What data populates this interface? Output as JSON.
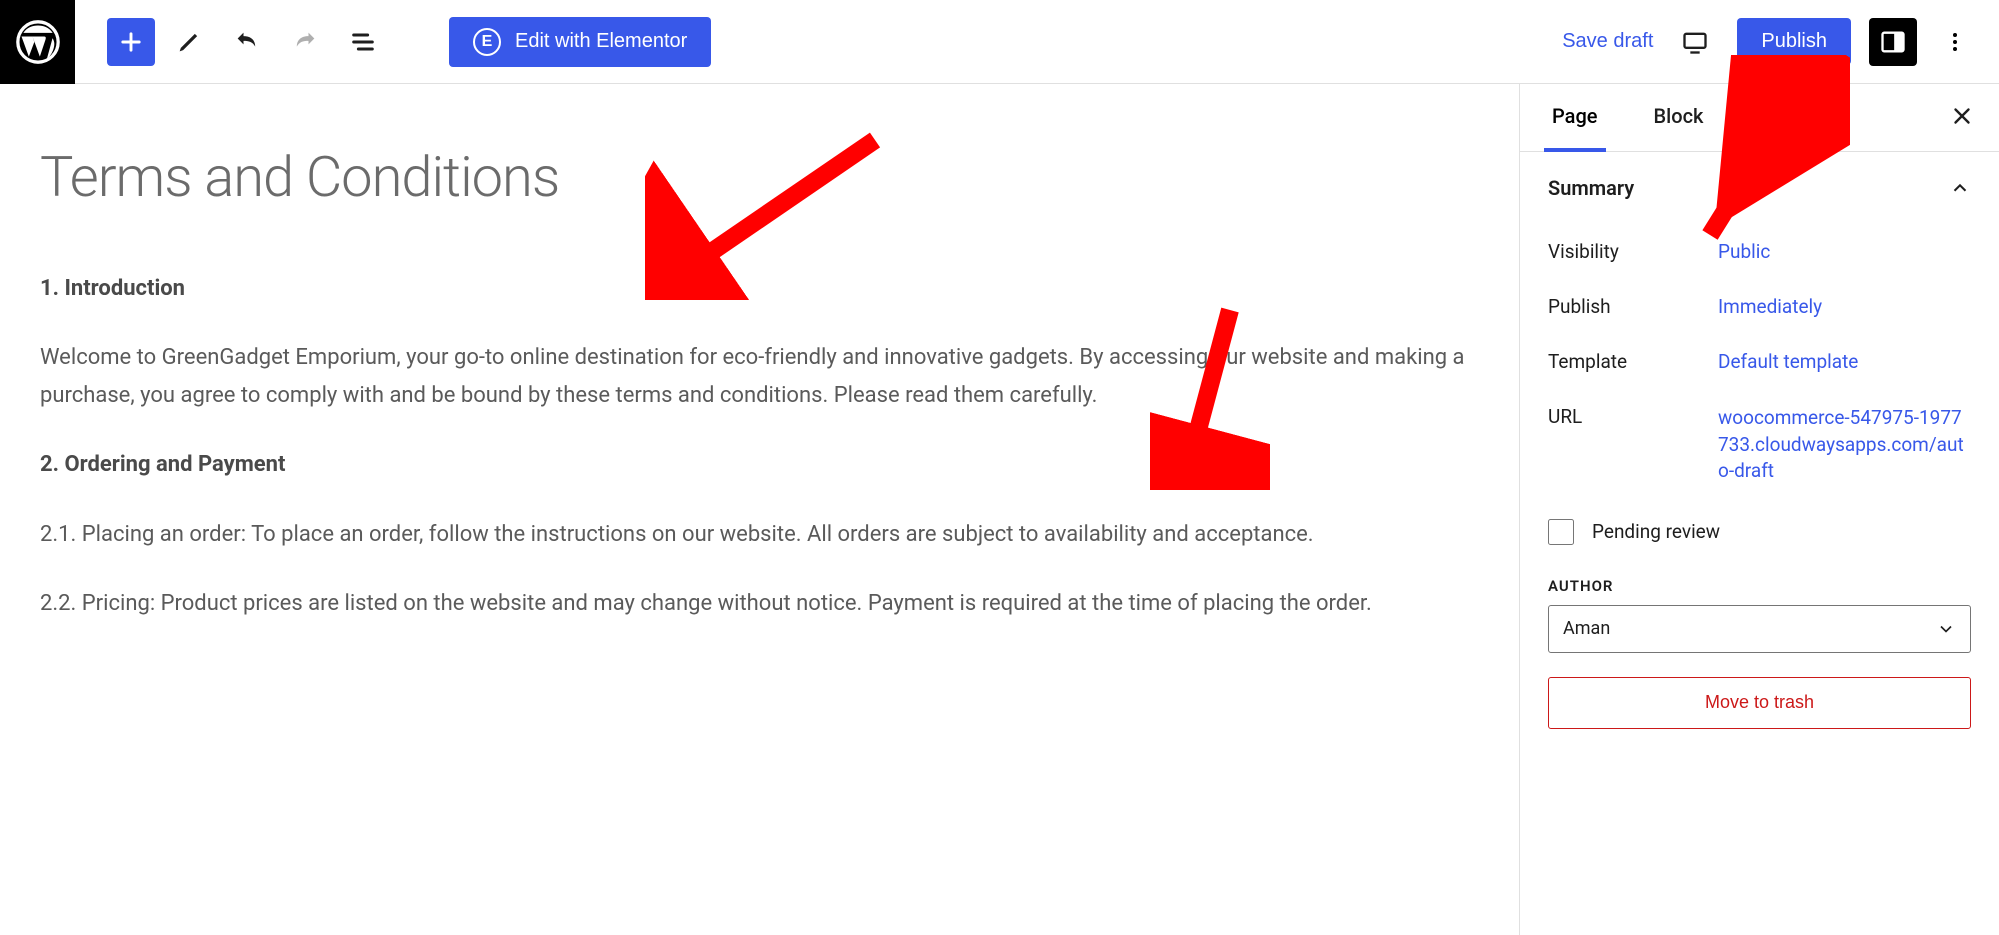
{
  "toolbar": {
    "elementor_label": "Edit with Elementor",
    "save_draft": "Save draft",
    "publish": "Publish"
  },
  "editor": {
    "title": "Terms and Conditions",
    "blocks": [
      {
        "type": "bold",
        "text": "1. Introduction"
      },
      {
        "type": "p",
        "text": "Welcome to GreenGadget Emporium, your go-to online destination for eco-friendly and innovative gadgets. By accessing our website and making a purchase, you agree to comply with and be bound by these terms and conditions. Please read them carefully."
      },
      {
        "type": "bold",
        "text": "2. Ordering and Payment"
      },
      {
        "type": "p",
        "text": "2.1. Placing an order: To place an order, follow the instructions on our website. All orders are subject to availability and acceptance."
      },
      {
        "type": "p",
        "text": "2.2. Pricing: Product prices are listed on the website and may change without notice. Payment is required at the time of placing the order."
      }
    ]
  },
  "sidebar": {
    "tabs": {
      "page": "Page",
      "block": "Block"
    },
    "summary_label": "Summary",
    "visibility_label": "Visibility",
    "visibility_value": "Public",
    "publish_label": "Publish",
    "publish_value": "Immediately",
    "template_label": "Template",
    "template_value": "Default template",
    "url_label": "URL",
    "url_value": "woocommerce-547975-1977733.cloudwaysapps.com/auto-draft",
    "pending_review": "Pending review",
    "author_label": "AUTHOR",
    "author_value": "Aman",
    "trash_label": "Move to trash"
  }
}
